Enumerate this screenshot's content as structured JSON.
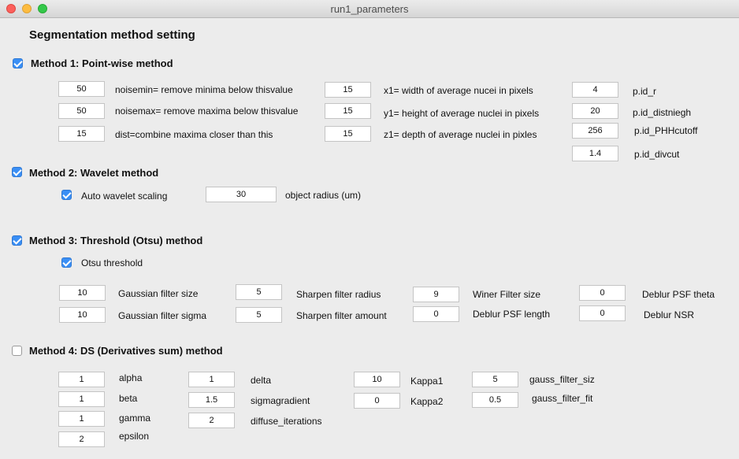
{
  "window": {
    "title": "run1_parameters"
  },
  "heading": "Segmentation method setting",
  "method1": {
    "title": "Method 1:  Point-wise method",
    "checked": true,
    "fields": [
      {
        "value": "50",
        "label": "noisemin= remove minima below thisvalue"
      },
      {
        "value": "50",
        "label": "noisemax= remove maxima below thisvalue"
      },
      {
        "value": "15",
        "label": "dist=combine maxima closer than this"
      },
      {
        "value": "15",
        "label": "x1= width of average nucei in pixels"
      },
      {
        "value": "15",
        "label": "y1= height of average nuclei in pixels"
      },
      {
        "value": "15",
        "label": "z1= depth of average nuclei in pixles"
      },
      {
        "value": "4",
        "label": "p.id_r"
      },
      {
        "value": "20",
        "label": "p.id_distniegh"
      },
      {
        "value": "256",
        "label": "p.id_PHHcutoff"
      },
      {
        "value": "1.4",
        "label": "p.id_divcut"
      }
    ]
  },
  "method2": {
    "title": "Method 2:  Wavelet method",
    "checked": true,
    "auto_scaling_label": "Auto wavelet scaling",
    "auto_scaling_checked": true,
    "radius_value": "30",
    "radius_label": "object radius (um)"
  },
  "method3": {
    "title": "Method 3:  Threshold (Otsu) method",
    "checked": true,
    "otsu_label": "Otsu threshold",
    "otsu_checked": true,
    "fields": [
      {
        "value": "10",
        "label": "Gaussian filter size"
      },
      {
        "value": "10",
        "label": "Gaussian filter sigma"
      },
      {
        "value": "5",
        "label": "Sharpen filter radius"
      },
      {
        "value": "5",
        "label": "Sharpen filter amount"
      },
      {
        "value": "9",
        "label": "Winer Filter size"
      },
      {
        "value": "0",
        "label": "Deblur PSF length"
      },
      {
        "value": "0",
        "label": "Deblur PSF theta"
      },
      {
        "value": "0",
        "label": "Deblur NSR"
      }
    ]
  },
  "method4": {
    "title": "Method 4:  DS (Derivatives sum) method",
    "checked": false,
    "fields": [
      {
        "value": "1",
        "label": "alpha"
      },
      {
        "value": "1",
        "label": "beta"
      },
      {
        "value": "1",
        "label": "gamma"
      },
      {
        "value": "2",
        "label": "epsilon"
      },
      {
        "value": "1",
        "label": "delta"
      },
      {
        "value": "1.5",
        "label": "sigmagradient"
      },
      {
        "value": "2",
        "label": "diffuse_iterations"
      },
      {
        "value": "10",
        "label": "Kappa1"
      },
      {
        "value": "0",
        "label": "Kappa2"
      },
      {
        "value": "5",
        "label": "gauss_filter_siz"
      },
      {
        "value": "0.5",
        "label": "gauss_filter_fit"
      }
    ]
  }
}
